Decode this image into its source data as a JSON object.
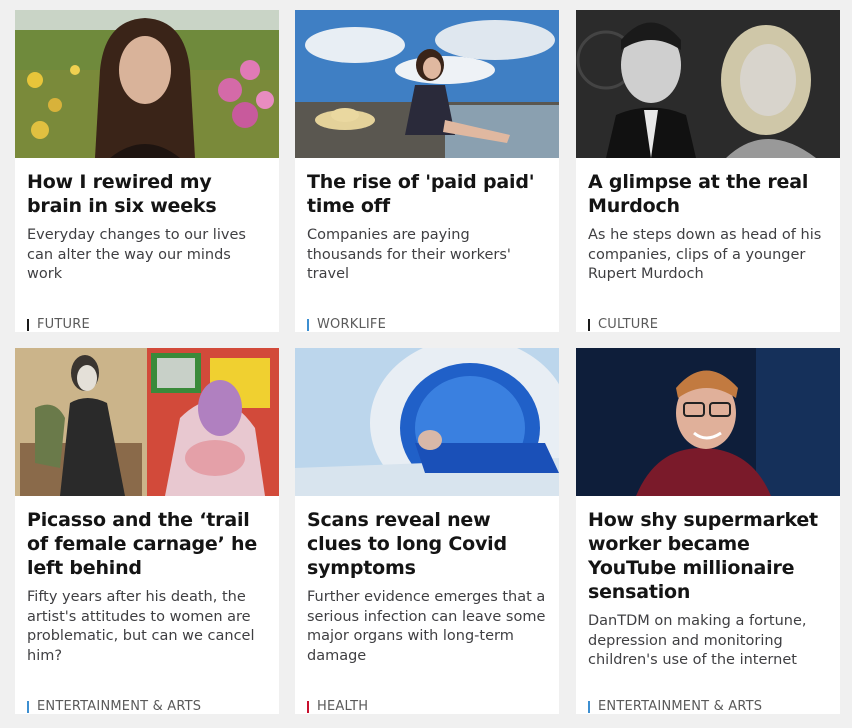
{
  "cards": [
    {
      "title": "How I rewired my brain in six weeks",
      "summary": "Everyday changes to our lives can alter the way our minds work",
      "section": "FUTURE",
      "section_color": "#1a1a1a"
    },
    {
      "title": "The rise of 'paid paid' time off",
      "summary": "Companies are paying thousands for their workers' travel",
      "section": "WORKLIFE",
      "section_color": "#3d8fd1"
    },
    {
      "title": "A glimpse at the real Murdoch",
      "summary": "As he steps down as head of his companies, clips of a younger Rupert Murdoch",
      "section": "CULTURE",
      "section_color": "#1a1a1a"
    },
    {
      "title": "Picasso and the ‘trail of female carnage’ he left behind",
      "summary": "Fifty years after his death, the artist's attitudes to women are problematic, but can we cancel him?",
      "section": "ENTERTAINMENT & ARTS",
      "section_color": "#3d8fd1"
    },
    {
      "title": "Scans reveal new clues to long Covid symptoms",
      "summary": "Further evidence emerges that a serious infection can leave some major organs with long-term damage",
      "section": "HEALTH",
      "section_color": "#c8102e"
    },
    {
      "title": "How shy supermarket worker became YouTube millionaire sensation",
      "summary": "DanTDM on making a fortune, depression and monitoring children's use of the internet",
      "section": "ENTERTAINMENT & ARTS",
      "section_color": "#3d8fd1"
    }
  ]
}
